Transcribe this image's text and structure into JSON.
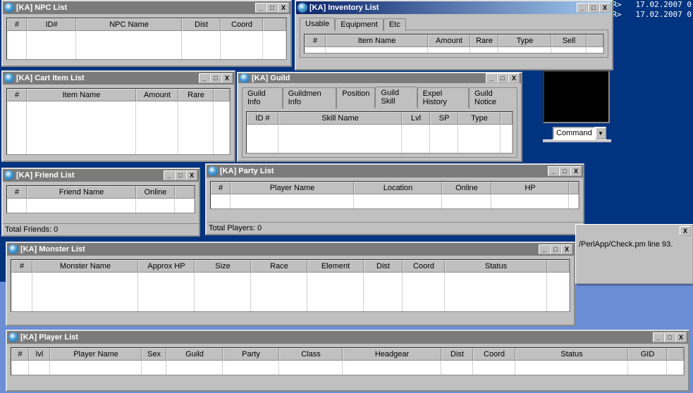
{
  "desktop_log": "R>   17.02.2007 0\nR>   17.02.2007 0",
  "npc_window": {
    "title": "[KA] NPC List",
    "cols": [
      "#",
      "ID#",
      "NPC Name",
      "Dist",
      "Coord"
    ]
  },
  "inventory_window": {
    "title": "[KA] Inventory List",
    "tabs": [
      "Usable",
      "Equipment",
      "Etc"
    ],
    "active_tab": 0,
    "cols": [
      "#",
      "Item Name",
      "Amount",
      "Rare",
      "Type",
      "Sell"
    ]
  },
  "cart_window": {
    "title": "[KA] Cart Item List",
    "cols": [
      "#",
      "Item Name",
      "Amount",
      "Rare"
    ]
  },
  "guild_window": {
    "title": "[KA] Guild",
    "tabs": [
      "Guild Info",
      "Guildmen Info",
      "Position",
      "Guild Skill",
      "Expel History",
      "Guild Notice"
    ],
    "active_tab": 3,
    "cols": [
      "ID #",
      "Skill Name",
      "Lvl",
      "SP",
      "Type"
    ]
  },
  "friend_window": {
    "title": "[KA] Friend List",
    "cols": [
      "#",
      "Friend Name",
      "Online"
    ],
    "status": "Total Friends: 0"
  },
  "party_window": {
    "title": "[KA] Party List",
    "cols": [
      "#",
      "Player Name",
      "Location",
      "Online",
      "HP"
    ],
    "status": "Total Players: 0"
  },
  "monster_window": {
    "title": "[KA] Monster List",
    "cols": [
      "#",
      "Monster Name",
      "Approx HP",
      "Size",
      "Race",
      "Element",
      "Dist",
      "Coord",
      "Status"
    ]
  },
  "player_window": {
    "title": "[KA] Player List",
    "cols": [
      "#",
      "lvl",
      "Player Name",
      "Sex",
      "Guild",
      "Party",
      "Class",
      "Headgear",
      "Dist",
      "Coord",
      "Status",
      "GID"
    ]
  },
  "combo_value": "Command",
  "tooltip_text": "/PerlApp/Check.pm line 93.",
  "btn_min": "_",
  "btn_max": "□",
  "btn_close": "X",
  "combo_arrow": "▼"
}
